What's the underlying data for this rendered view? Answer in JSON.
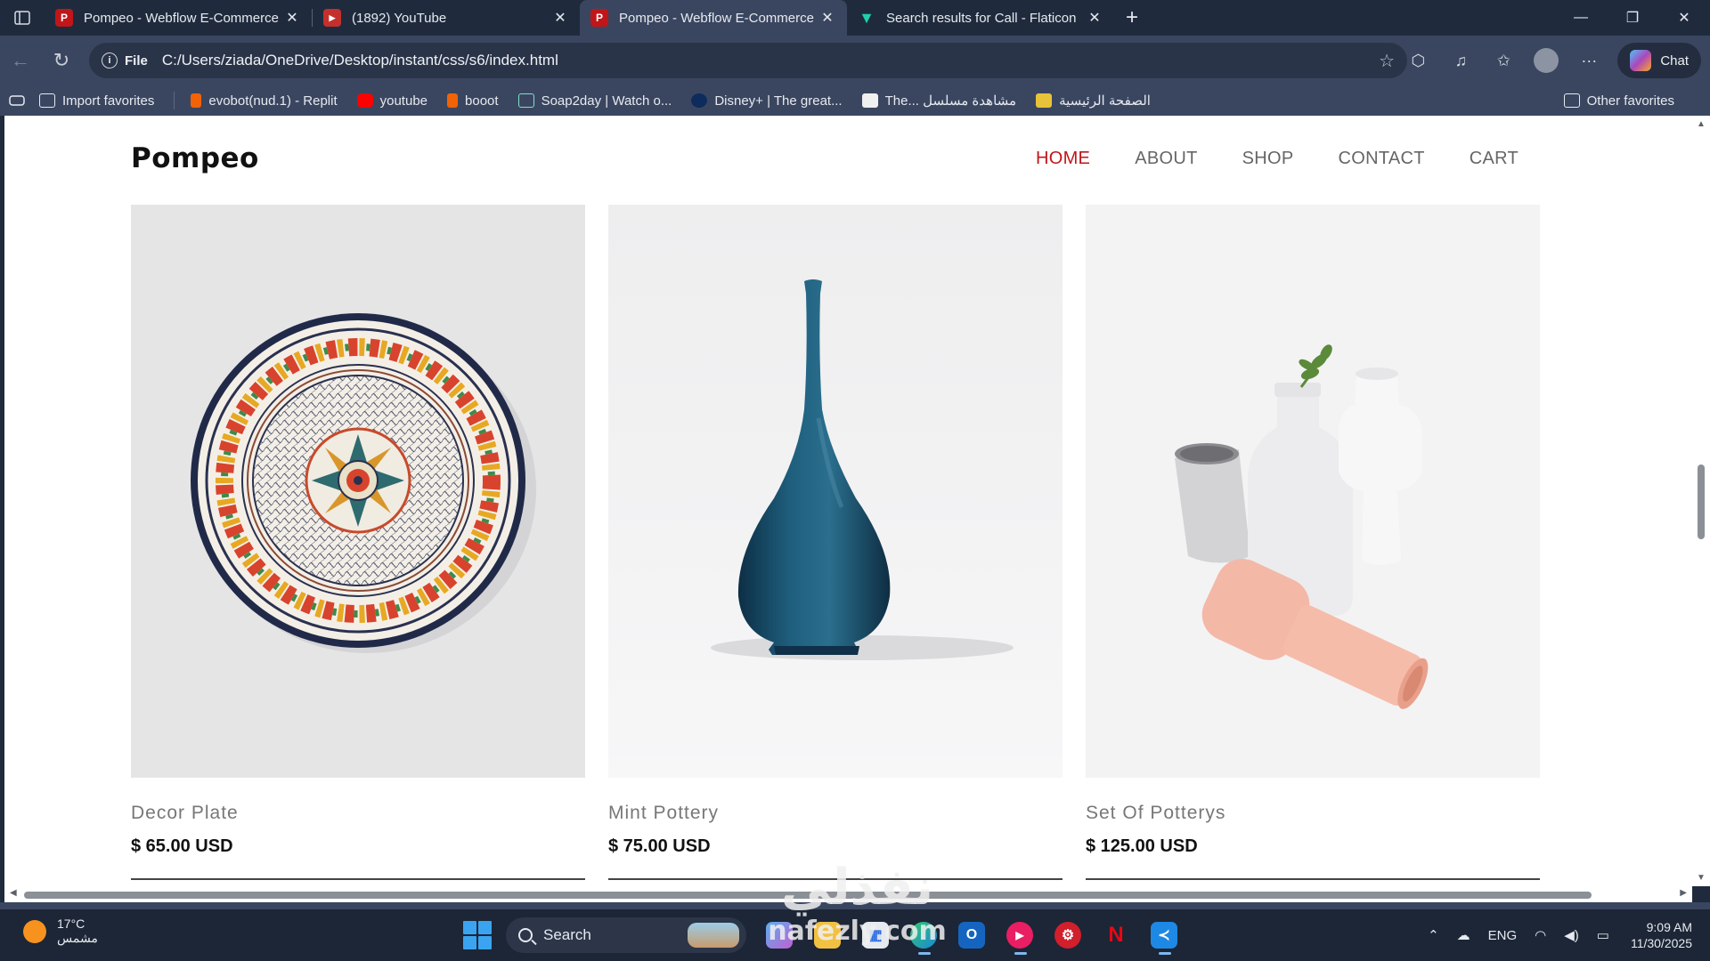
{
  "browser": {
    "tabs": [
      {
        "title": "Pompeo - Webflow E-Commerce",
        "icon": "pompeo-favicon",
        "color": "#c0161a",
        "active": false
      },
      {
        "title": "(1892) YouTube",
        "icon": "youtube-favicon",
        "color": "#c4302b",
        "active": false
      },
      {
        "title": "Pompeo - Webflow E-Commerce",
        "icon": "pompeo-favicon",
        "color": "#c0161a",
        "active": true
      },
      {
        "title": "Search results for Call - Flaticon",
        "icon": "flaticon-favicon",
        "color": "#1fd1a8",
        "active": false
      }
    ],
    "address": {
      "scheme": "File",
      "url": "C:/Users/ziada/OneDrive/Desktop/instant/css/s6/index.html"
    },
    "chat_label": "Chat",
    "bookmarks": [
      {
        "label": "Import favorites",
        "icon": "import-icon"
      },
      {
        "label": "evobot(nud.1) - Replit",
        "icon": "replit-icon"
      },
      {
        "label": "youtube",
        "icon": "youtube-icon"
      },
      {
        "label": "booot",
        "icon": "replit-icon"
      },
      {
        "label": "Soap2day | Watch o...",
        "icon": "soap2day-icon"
      },
      {
        "label": "Disney+ | The great...",
        "icon": "disney-icon"
      },
      {
        "label": "The... مشاهدة مسلسل",
        "icon": "page-icon"
      },
      {
        "label": "الصفحة الرئيسية",
        "icon": "home-page-icon"
      }
    ],
    "other_favorites": "Other favorites"
  },
  "site": {
    "brand": "Pompeo",
    "nav": [
      {
        "label": "HOME",
        "active": true
      },
      {
        "label": "ABOUT",
        "active": false
      },
      {
        "label": "SHOP",
        "active": false
      },
      {
        "label": "CONTACT",
        "active": false
      },
      {
        "label": "CART",
        "active": false
      }
    ],
    "accent_color": "#c0161a",
    "products": [
      {
        "name": "Decor Plate",
        "price": "$ 65.00 USD",
        "image": "decor-plate-image"
      },
      {
        "name": "Mint Pottery",
        "price": "$ 75.00 USD",
        "image": "blue-vase-image"
      },
      {
        "name": "Set Of Potterys",
        "price": "$ 125.00 USD",
        "image": "pottery-set-image"
      }
    ]
  },
  "taskbar": {
    "weather": {
      "temp": "17°C",
      "condition": "مشمس"
    },
    "search_label": "Search",
    "language": "ENG",
    "time": "9:09 AM",
    "date": "11/30/2025"
  },
  "watermark": {
    "arabic": "نفذلي",
    "latin": "nafezly.com"
  }
}
